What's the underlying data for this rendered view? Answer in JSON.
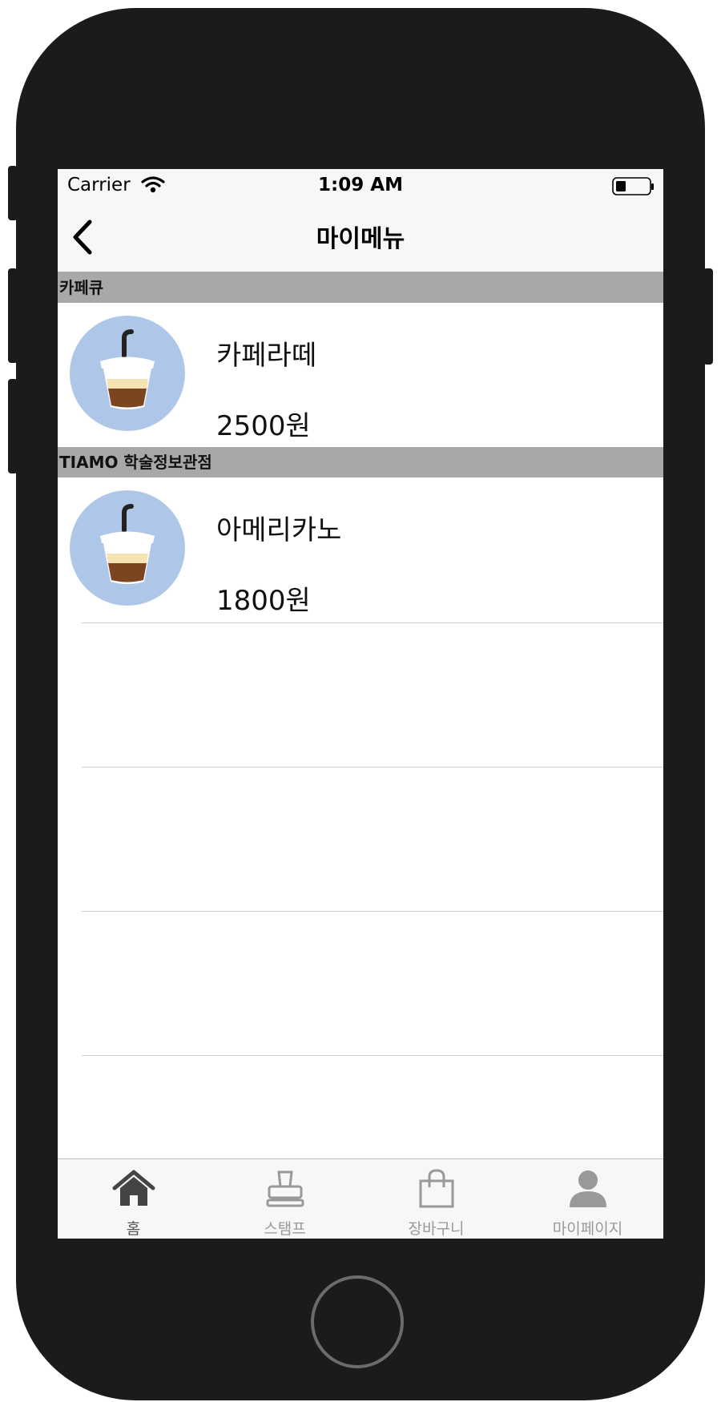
{
  "status_bar": {
    "carrier": "Carrier",
    "time": "1:09 AM",
    "wifi_icon": "wifi-icon",
    "battery_icon": "battery-icon"
  },
  "nav": {
    "title": "마이메뉴",
    "back_icon": "chevron-left-icon"
  },
  "sections": [
    {
      "header": "카페큐",
      "item": {
        "name": "카페라떼",
        "price": "2500원",
        "image_icon": "iced-coffee-cup-icon"
      }
    },
    {
      "header": "TIAMO 학술정보관점",
      "item": {
        "name": "아메리카노",
        "price": "1800원",
        "image_icon": "iced-coffee-cup-icon"
      }
    }
  ],
  "tabs": [
    {
      "label": "홈",
      "icon": "home-icon",
      "active": true
    },
    {
      "label": "스탬프",
      "icon": "stamp-icon",
      "active": false
    },
    {
      "label": "장바구니",
      "icon": "shopping-bag-icon",
      "active": false
    },
    {
      "label": "마이페이지",
      "icon": "person-icon",
      "active": false
    }
  ],
  "colors": {
    "section_header": "#a8a8a8",
    "thumb_bg": "#aec7e8",
    "coffee": "#7a4520",
    "cream": "#f5e3b3",
    "device": "#1b1b1b"
  }
}
